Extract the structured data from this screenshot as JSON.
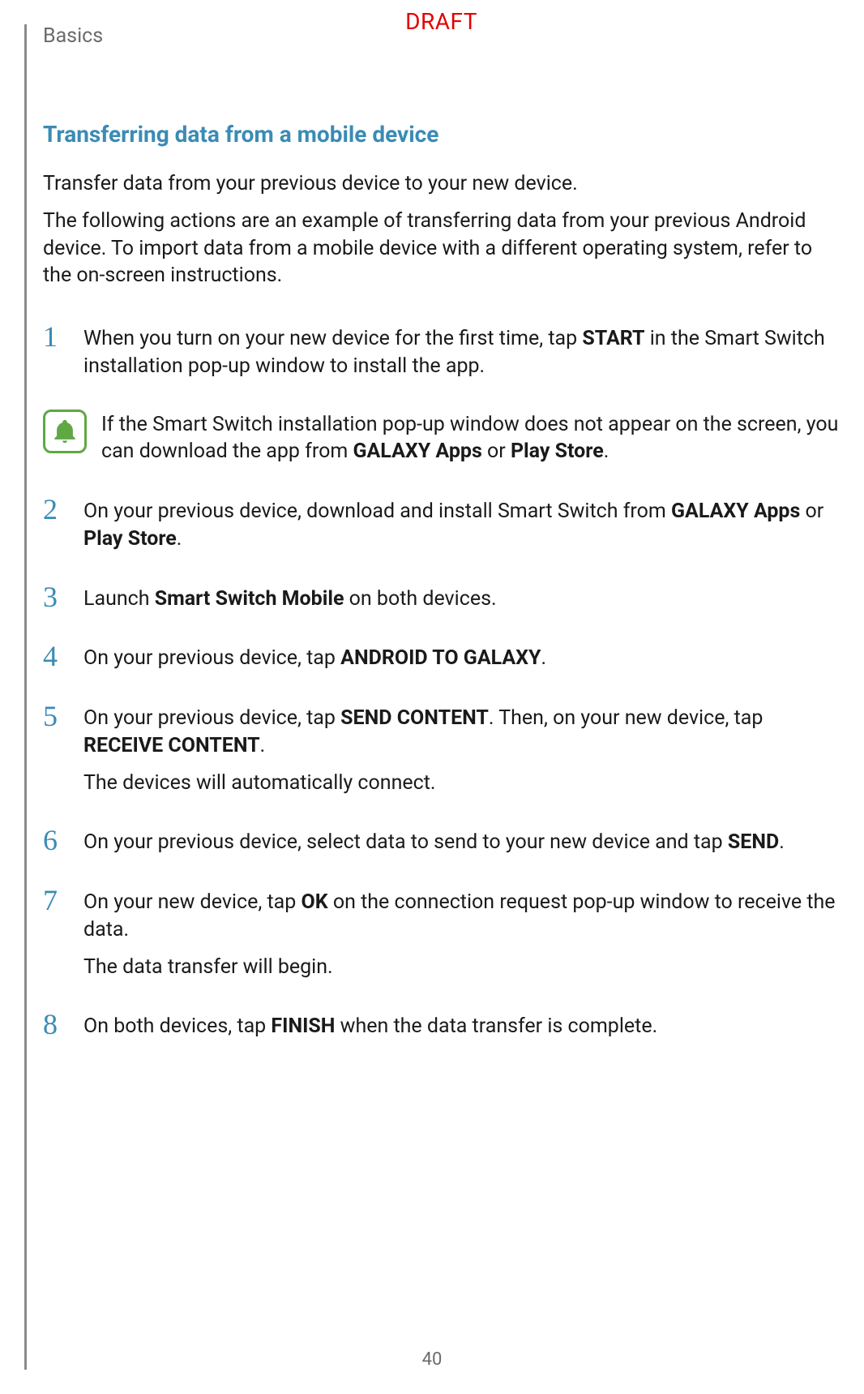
{
  "header": {
    "section": "Basics",
    "draft": "DRAFT"
  },
  "subheading": "Transferring data from a mobile device",
  "intro": {
    "p1": "Transfer data from your previous device to your new device.",
    "p2": "The following actions are an example of transferring data from your previous Android device. To import data from a mobile device with a different operating system, refer to the on-screen instructions."
  },
  "steps": {
    "s1": {
      "num": "1",
      "pre": "When you turn on your new device for the first time, tap ",
      "bold1": "START",
      "post": " in the Smart Switch installation pop-up window to install the app."
    },
    "note": {
      "pre": "If the Smart Switch installation pop-up window does not appear on the screen, you can download the app from ",
      "bold1": "GALAXY Apps",
      "mid": " or ",
      "bold2": "Play Store",
      "post": "."
    },
    "s2": {
      "num": "2",
      "pre": "On your previous device, download and install Smart Switch from ",
      "bold1": "GALAXY Apps",
      "mid": " or ",
      "bold2": "Play Store",
      "post": "."
    },
    "s3": {
      "num": "3",
      "pre": "Launch ",
      "bold1": "Smart Switch Mobile",
      "post": " on both devices."
    },
    "s4": {
      "num": "4",
      "pre": "On your previous device, tap ",
      "bold1": "ANDROID TO GALAXY",
      "post": "."
    },
    "s5": {
      "num": "5",
      "pre": "On your previous device, tap ",
      "bold1": "SEND CONTENT",
      "mid": ". Then, on your new device, tap ",
      "bold2": "RECEIVE CONTENT",
      "post": ".",
      "extra": "The devices will automatically connect."
    },
    "s6": {
      "num": "6",
      "pre": "On your previous device, select data to send to your new device and tap ",
      "bold1": "SEND",
      "post": "."
    },
    "s7": {
      "num": "7",
      "pre": "On your new device, tap ",
      "bold1": "OK",
      "post": " on the connection request pop-up window to receive the data.",
      "extra": "The data transfer will begin."
    },
    "s8": {
      "num": "8",
      "pre": "On both devices, tap ",
      "bold1": "FINISH",
      "post": " when the data transfer is complete."
    }
  },
  "pageNumber": "40"
}
